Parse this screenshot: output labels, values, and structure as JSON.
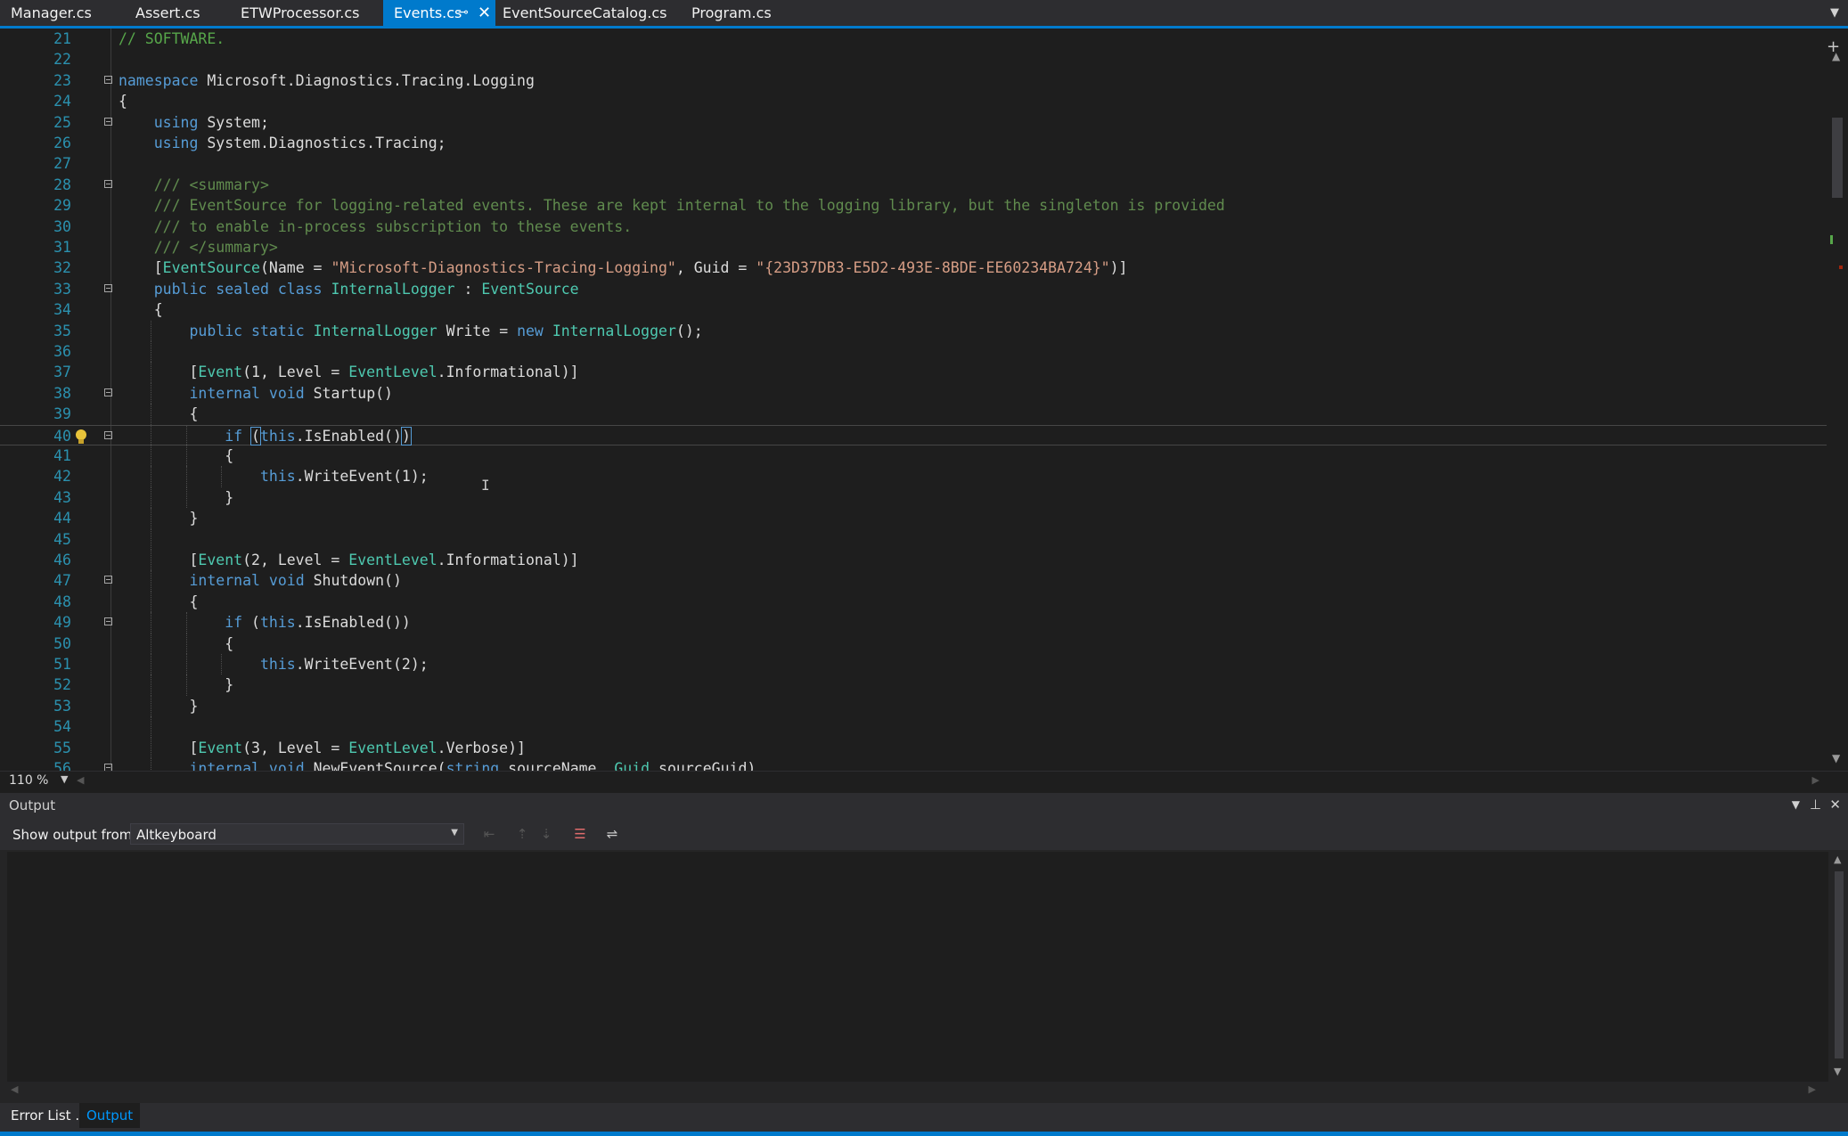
{
  "tabs": [
    {
      "label": "Manager.cs",
      "active": false
    },
    {
      "label": "Assert.cs",
      "active": false
    },
    {
      "label": "ETWProcessor.cs",
      "active": false
    },
    {
      "label": "Events.cs",
      "active": true
    },
    {
      "label": "EventSourceCatalog.cs",
      "active": false
    },
    {
      "label": "Program.cs",
      "active": false
    }
  ],
  "editor": {
    "zoom": "110 %",
    "current_line": 40,
    "lines": [
      {
        "n": "21",
        "fold": false,
        "guides": [],
        "html": "<span class=\"cm\">// SOFTWARE.</span>"
      },
      {
        "n": "22",
        "fold": false,
        "guides": [],
        "html": ""
      },
      {
        "n": "23",
        "fold": true,
        "guides": [],
        "html": "<span class=\"kw\">namespace</span> Microsoft.Diagnostics.Tracing.Logging"
      },
      {
        "n": "24",
        "fold": false,
        "guides": [],
        "html": "{"
      },
      {
        "n": "25",
        "fold": true,
        "guides": [],
        "html": "    <span class=\"kw\">using</span> System;"
      },
      {
        "n": "26",
        "fold": false,
        "guides": [],
        "html": "    <span class=\"kw\">using</span> System.Diagnostics.Tracing;"
      },
      {
        "n": "27",
        "fold": false,
        "guides": [],
        "html": ""
      },
      {
        "n": "28",
        "fold": true,
        "guides": [],
        "html": "    <span class=\"cd\">/// &lt;summary&gt;</span>"
      },
      {
        "n": "29",
        "fold": false,
        "guides": [],
        "html": "    <span class=\"cd\">/// EventSource for logging-related events. These are kept internal to the logging library, but the singleton is provided</span>"
      },
      {
        "n": "30",
        "fold": false,
        "guides": [],
        "html": "    <span class=\"cd\">/// to enable in-process subscription to these events.</span>"
      },
      {
        "n": "31",
        "fold": false,
        "guides": [],
        "html": "    <span class=\"cd\">/// &lt;/summary&gt;</span>"
      },
      {
        "n": "32",
        "fold": false,
        "guides": [],
        "html": "    [<span class=\"ty\">EventSource</span>(Name = <span class=\"st\">\"Microsoft-Diagnostics-Tracing-Logging\"</span>, Guid = <span class=\"st\">\"{23D37DB3-E5D2-493E-8BDE-EE60234BA724}\"</span>)]"
      },
      {
        "n": "33",
        "fold": true,
        "guides": [],
        "html": "    <span class=\"kw\">public</span> <span class=\"kw\">sealed</span> <span class=\"kw\">class</span> <span class=\"ty\">InternalLogger</span> : <span class=\"ty\">EventSource</span>"
      },
      {
        "n": "34",
        "fold": false,
        "guides": [],
        "html": "    {"
      },
      {
        "n": "35",
        "fold": false,
        "guides": [
          1
        ],
        "html": "        <span class=\"kw\">public</span> <span class=\"kw\">static</span> <span class=\"ty\">InternalLogger</span> Write = <span class=\"kw\">new</span> <span class=\"ty\">InternalLogger</span>();"
      },
      {
        "n": "36",
        "fold": false,
        "guides": [
          1
        ],
        "html": ""
      },
      {
        "n": "37",
        "fold": false,
        "guides": [
          1
        ],
        "html": "        [<span class=\"ty\">Event</span>(1, Level = <span class=\"ty\">EventLevel</span>.Informational)]"
      },
      {
        "n": "38",
        "fold": true,
        "guides": [
          1
        ],
        "html": "        <span class=\"kw\">internal</span> <span class=\"kw\">void</span> Startup()"
      },
      {
        "n": "39",
        "fold": false,
        "guides": [
          1
        ],
        "html": "        {"
      },
      {
        "n": "40",
        "fold": true,
        "guides": [
          1,
          2
        ],
        "bulb": true,
        "html": "            <span class=\"kw\">if</span> <span class=\"hl\">(</span><span class=\"kw\">this</span>.IsEnabled()<span class=\"hl\">)</span>"
      },
      {
        "n": "41",
        "fold": false,
        "guides": [
          1,
          2
        ],
        "html": "            {"
      },
      {
        "n": "42",
        "fold": false,
        "guides": [
          1,
          2,
          3
        ],
        "html": "                <span class=\"kw\">this</span>.WriteEvent(1);"
      },
      {
        "n": "43",
        "fold": false,
        "guides": [
          1,
          2
        ],
        "html": "            }"
      },
      {
        "n": "44",
        "fold": false,
        "guides": [
          1
        ],
        "html": "        }"
      },
      {
        "n": "45",
        "fold": false,
        "guides": [
          1
        ],
        "html": ""
      },
      {
        "n": "46",
        "fold": false,
        "guides": [
          1
        ],
        "html": "        [<span class=\"ty\">Event</span>(2, Level = <span class=\"ty\">EventLevel</span>.Informational)]"
      },
      {
        "n": "47",
        "fold": true,
        "guides": [
          1
        ],
        "html": "        <span class=\"kw\">internal</span> <span class=\"kw\">void</span> Shutdown()"
      },
      {
        "n": "48",
        "fold": false,
        "guides": [
          1
        ],
        "html": "        {"
      },
      {
        "n": "49",
        "fold": true,
        "guides": [
          1,
          2
        ],
        "html": "            <span class=\"kw\">if</span> (<span class=\"kw\">this</span>.IsEnabled())"
      },
      {
        "n": "50",
        "fold": false,
        "guides": [
          1,
          2
        ],
        "html": "            {"
      },
      {
        "n": "51",
        "fold": false,
        "guides": [
          1,
          2,
          3
        ],
        "html": "                <span class=\"kw\">this</span>.WriteEvent(2);"
      },
      {
        "n": "52",
        "fold": false,
        "guides": [
          1,
          2
        ],
        "html": "            }"
      },
      {
        "n": "53",
        "fold": false,
        "guides": [
          1
        ],
        "html": "        }"
      },
      {
        "n": "54",
        "fold": false,
        "guides": [
          1
        ],
        "html": ""
      },
      {
        "n": "55",
        "fold": false,
        "guides": [
          1
        ],
        "html": "        [<span class=\"ty\">Event</span>(3, Level = <span class=\"ty\">EventLevel</span>.Verbose)]"
      },
      {
        "n": "56",
        "fold": true,
        "guides": [
          1
        ],
        "html": "        <span class=\"kw\">internal</span> <span class=\"kw\">void</span> NewEventSource(<span class=\"kw\">string</span> sourceName, <span class=\"ty\">Guid</span> sourceGuid)"
      }
    ]
  },
  "output": {
    "title": "Output",
    "show_output_label": "Show output from:",
    "source": "Altkeyboard",
    "content": ""
  },
  "bottom_tabs": [
    {
      "label": "Error List ...",
      "active": false
    },
    {
      "label": "Output",
      "active": true
    }
  ],
  "colors": {
    "accent": "#007acc",
    "background": "#1e1e1e",
    "keyword": "#569cd6",
    "type": "#4ec9b0",
    "string": "#d69d85",
    "comment": "#57a64a",
    "line_number": "#2b91af"
  },
  "icons": {
    "pin": "pin-icon",
    "close": "close-icon",
    "lightbulb": "lightbulb-icon",
    "clear_all": "clear-all-icon",
    "word_wrap": "word-wrap-icon"
  }
}
